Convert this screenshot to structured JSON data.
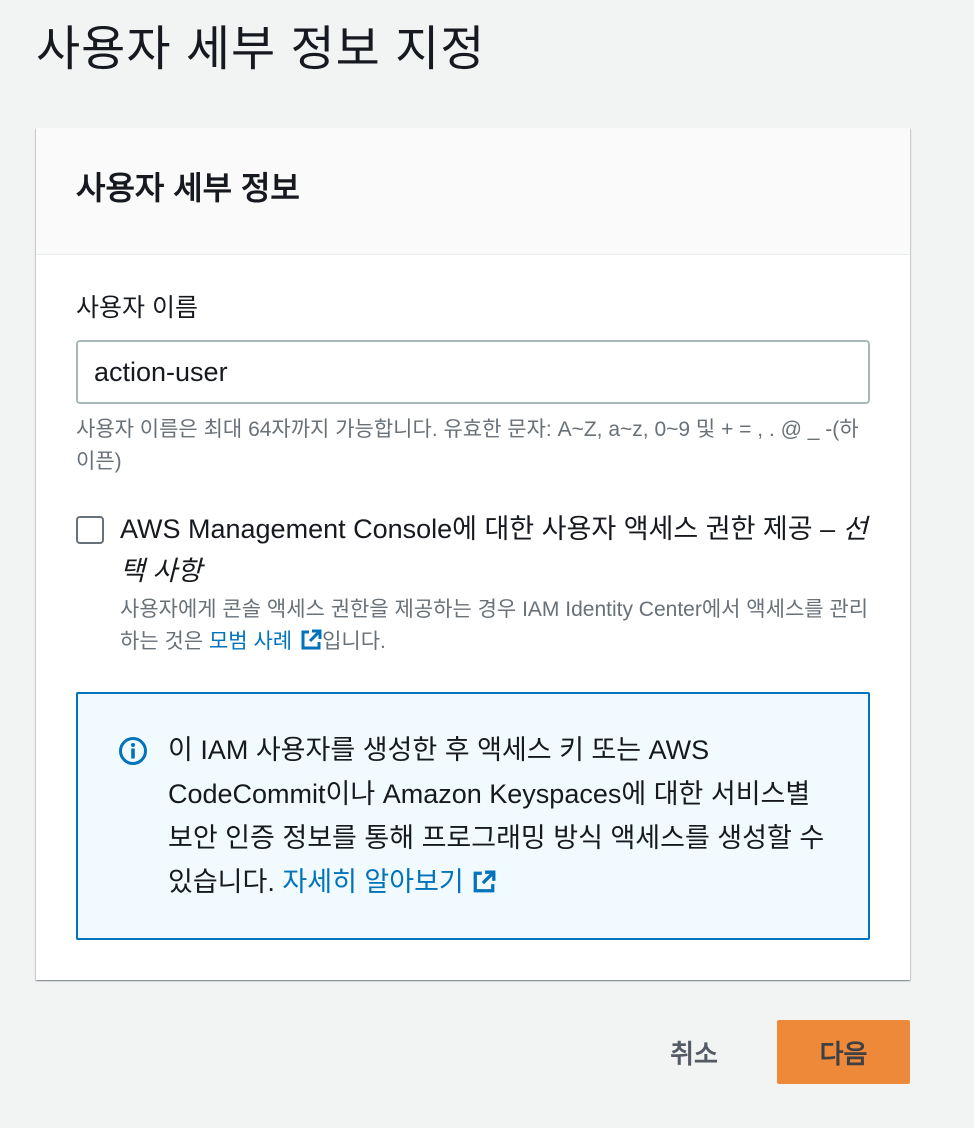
{
  "page": {
    "title": "사용자 세부 정보 지정"
  },
  "container": {
    "header": "사용자 세부 정보"
  },
  "username_field": {
    "label": "사용자 이름",
    "value": "action-user",
    "hint": "사용자 이름은 최대 64자까지 가능합니다. 유효한 문자: A~Z, a~z, 0~9 및 + = , . @ _ -(하이픈)"
  },
  "console_access": {
    "checked": false,
    "label": "AWS Management Console에 대한 사용자 액세스 권한 제공 –",
    "label_optional": "선택 사항",
    "description_before": "사용자에게 콘솔 액세스 권한을 제공하는 경우 IAM Identity Center에서 액세스를 관리하는 것은",
    "description_link": "모범 사례",
    "description_after": "입니다."
  },
  "info_alert": {
    "icon": "info-circle-icon",
    "text": "이 IAM 사용자를 생성한 후 액세스 키 또는 AWS CodeCommit이나 Amazon Keyspaces에 대한 서비스별 보안 인증 정보를 통해 프로그래밍 방식 액세스를 생성할 수 있습니다.",
    "link": "자세히 알아보기"
  },
  "actions": {
    "cancel_label": "취소",
    "next_label": "다음"
  },
  "colors": {
    "background": "#f2f3f3",
    "link": "#0073bb",
    "primary_button": "#ec7211",
    "info_background": "#f1faff",
    "info_border": "#0073bb"
  }
}
